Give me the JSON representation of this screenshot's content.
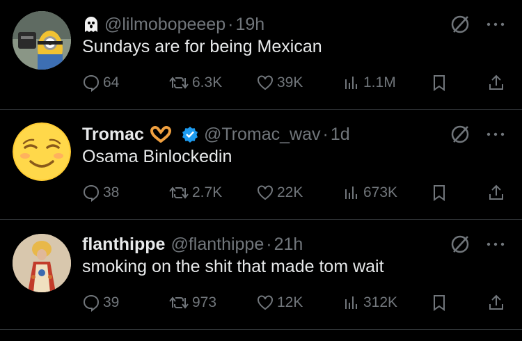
{
  "tweets": [
    {
      "name": "",
      "emoji_icon": "ghost-emoji-icon",
      "handle": "@lilmobopeeep",
      "dot": "·",
      "time": "19h",
      "verified": false,
      "text": "Sundays are for being Mexican",
      "replies": "64",
      "reposts": "6.3K",
      "likes": "39K",
      "views": "1.1M",
      "avatar": "minion-avatar"
    },
    {
      "name": "Tromac",
      "emoji_icon": "heart-hands-emoji-icon",
      "handle": "@Tromac_wav",
      "dot": "·",
      "time": "1d",
      "verified": true,
      "text": "Osama Binlockedin",
      "replies": "38",
      "reposts": "2.7K",
      "likes": "22K",
      "views": "673K",
      "avatar": "relieved-face-avatar"
    },
    {
      "name": "flanthippe",
      "emoji_icon": "",
      "handle": "@flanthippe",
      "dot": "·",
      "time": "21h",
      "verified": false,
      "text": "smoking on the shit that made tom wait",
      "replies": "39",
      "reposts": "973",
      "likes": "12K",
      "views": "312K",
      "avatar": "painting-avatar"
    }
  ],
  "colors": {
    "background": "#000000",
    "text": "#e7e9ea",
    "muted": "#71767b",
    "divider": "#2f3336",
    "verified": "#1d9bf0"
  }
}
